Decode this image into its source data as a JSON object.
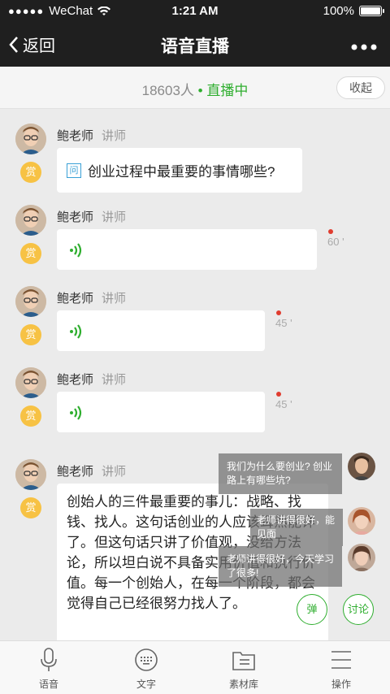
{
  "status_bar": {
    "carrier": "WeChat",
    "time": "1:21 AM",
    "battery": "100%"
  },
  "nav": {
    "back_label": "返回",
    "title": "语音直播"
  },
  "live": {
    "count": "18603人",
    "separator": "•",
    "status": "直播中",
    "collapse_label": "收起"
  },
  "teacher": {
    "name": "鲍老师",
    "role": "讲师",
    "reward_label": "赏"
  },
  "messages": [
    {
      "question_icon": "问",
      "question": "创业过程中最重要的事情哪些?"
    },
    {
      "duration": "60 '"
    },
    {
      "duration": "45 '"
    },
    {
      "duration": "45 '"
    },
    {
      "text": "创始人的三件最重要的事儿：战略、找钱、找人。这句话创业的人应该耳熟能详了。但这句话只讲了价值观，没给方法论，所以坦白说不具备实用价值和执行价值。每一个创始人，在每一个阶段，都会觉得自己已经很努力找人了。"
    }
  ],
  "danmaku": [
    {
      "text": "我们为什么要创业? 创业路上有哪些坑?"
    },
    {
      "text": "老师讲得很好，能见面"
    },
    {
      "text": "老师讲得很好，今天学习了很多!"
    }
  ],
  "buttons": {
    "barrage": "弹",
    "discuss": "讨论"
  },
  "tabs": [
    {
      "label": "语音",
      "icon": "microphone-icon"
    },
    {
      "label": "文字",
      "icon": "keyboard-icon"
    },
    {
      "label": "素材库",
      "icon": "folder-icon"
    },
    {
      "label": "操作",
      "icon": "menu-icon"
    }
  ],
  "colors": {
    "green": "#2fae2f",
    "reward": "#f7c244",
    "unread": "#e03c2f",
    "topbar": "#1f1f1f"
  }
}
